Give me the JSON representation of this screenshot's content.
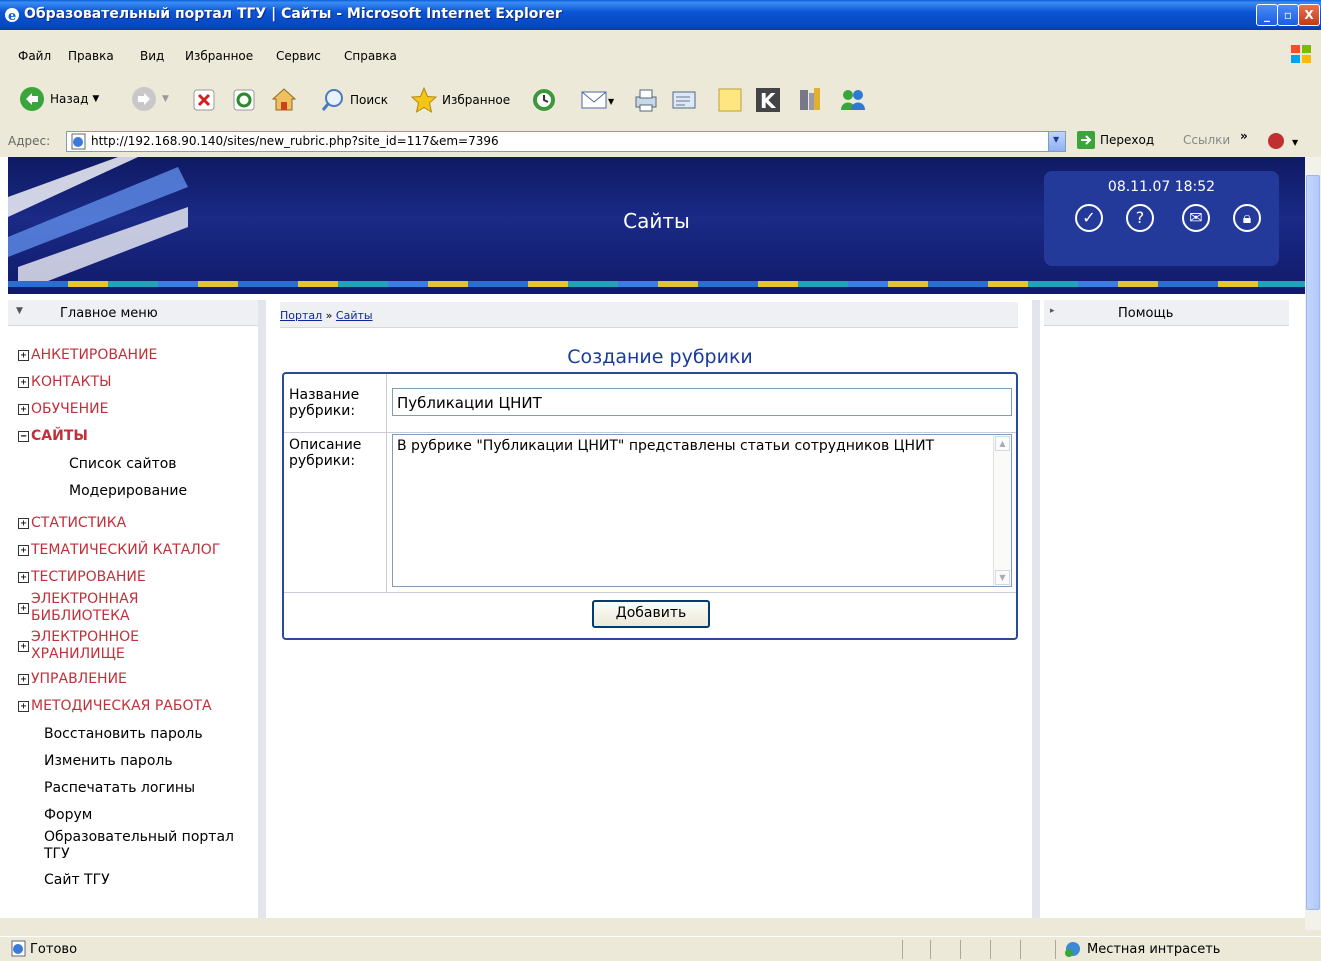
{
  "window": {
    "title": "Образовательный портал ТГУ | Сайты - Microsoft Internet Explorer",
    "buttons": {
      "minimize": "_",
      "maximize": "▫",
      "close": "X"
    }
  },
  "menubar": {
    "items": [
      "Файл",
      "Правка",
      "Вид",
      "Избранное",
      "Сервис",
      "Справка"
    ]
  },
  "toolbar": {
    "back": "Назад",
    "search": "Поиск",
    "favorites": "Избранное"
  },
  "address": {
    "label": "Адрес:",
    "url": "http://192.168.90.140/sites/new_rubric.php?site_id=117&em=7396",
    "go": "Переход",
    "links": "Ссылки"
  },
  "header": {
    "title": "Сайты",
    "datetime": "08.11.07 18:52"
  },
  "sidebar": {
    "title": "Главное меню",
    "items": [
      {
        "label": "АНКЕТИРОВАНИЕ",
        "state": "+"
      },
      {
        "label": "КОНТАКТЫ",
        "state": "+"
      },
      {
        "label": "ОБУЧЕНИЕ",
        "state": "+"
      },
      {
        "label": "САЙТЫ",
        "state": "−"
      },
      {
        "label": "СТАТИСТИКА",
        "state": "+"
      },
      {
        "label": "ТЕМАТИЧЕСКИЙ КАТАЛОГ",
        "state": "+"
      },
      {
        "label": "ТЕСТИРОВАНИЕ",
        "state": "+"
      },
      {
        "label": "ЭЛЕКТРОННАЯ БИБЛИОТЕКА",
        "state": "+"
      },
      {
        "label": "ЭЛЕКТРОННОЕ ХРАНИЛИЩЕ",
        "state": "+"
      },
      {
        "label": "УПРАВЛЕНИЕ",
        "state": "+"
      },
      {
        "label": "МЕТОДИЧЕСКАЯ РАБОТА",
        "state": "+"
      }
    ],
    "sites_sub": [
      "Список сайтов",
      "Модерирование"
    ],
    "links": [
      "Восстановить пароль",
      "Изменить пароль",
      "Распечатать логины",
      "Форум",
      "Образовательный портал ТГУ",
      "Сайт ТГУ"
    ]
  },
  "breadcrumb": {
    "portal": "Портал",
    "sep": "»",
    "current": "Сайты"
  },
  "form": {
    "heading": "Создание рубрики",
    "name_label": "Название рубрики:",
    "name_value": "Публикации ЦНИТ",
    "desc_label": "Описание рубрики:",
    "desc_value": "В рубрике \"Публикации ЦНИТ\" представлены статьи сотрудников ЦНИТ",
    "submit": "Добавить"
  },
  "rightpanel": {
    "title": "Помощь"
  },
  "status": {
    "left": "Готово",
    "zone": "Местная интрасеть"
  },
  "colors": {
    "title_bar": "#0b55d4",
    "banner": "#1a2a86",
    "menu_red": "#c0303a",
    "heading_blue": "#1a3a9c"
  }
}
